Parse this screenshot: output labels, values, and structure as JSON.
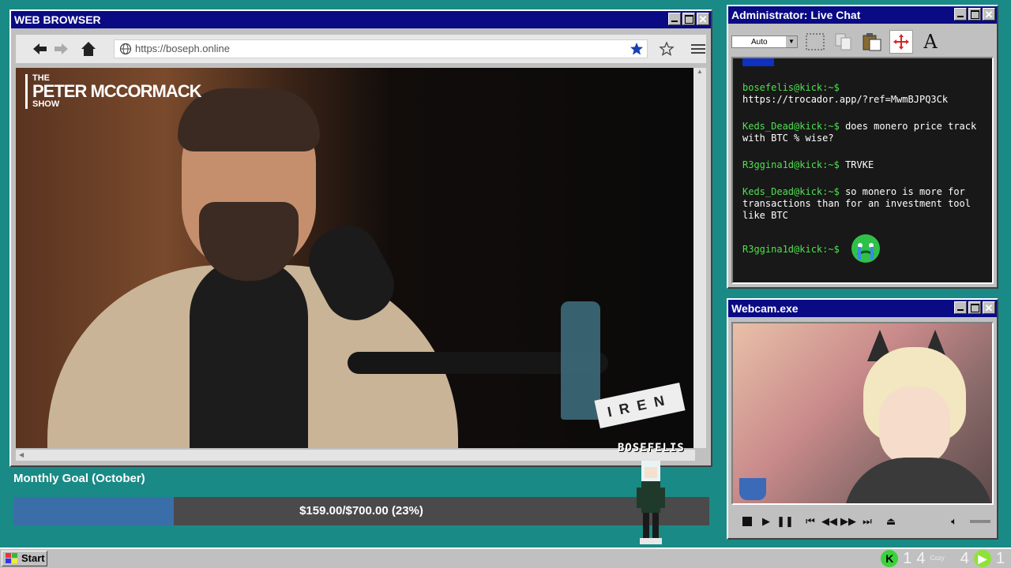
{
  "browser": {
    "title": "WEB BROWSER",
    "url": "https://boseph.online",
    "video": {
      "show_logo": [
        "THE",
        "PETER MCCORMACK",
        "SHOW"
      ],
      "sponsor": "IREN"
    }
  },
  "streamer_name": "BOSEFELIS",
  "goal": {
    "label": "Monthly Goal (October)",
    "text": "$159.00/$700.00 (23%)",
    "progress": 0.23
  },
  "chat": {
    "title": "Administrator: Live Chat",
    "auto_label": "Auto",
    "messages": [
      {
        "user": "bosefelis@kick:~$",
        "text": "https://trocador.app/?ref=MwmBJPQ3Ck"
      },
      {
        "user": "Keds_Dead@kick:~$",
        "text": "does monero price track with BTC % wise?"
      },
      {
        "user": "R3ggina1d@kick:~$",
        "text": "TRVKE"
      },
      {
        "user": "Keds_Dead@kick:~$",
        "text": "so monero is more for transactions than for an investment tool like BTC"
      },
      {
        "user": "R3ggina1d@kick:~$",
        "text": ""
      }
    ]
  },
  "webcam": {
    "title": "Webcam.exe"
  },
  "taskbar": {
    "start_label": "Start",
    "tray_items": [
      "1",
      "4",
      "4",
      "1"
    ],
    "tray_small_label": "Cozy"
  },
  "colors": {
    "desktop": "#1a8a86",
    "titlebar": "#0a0a84",
    "chat_user": "#4ee04e",
    "goal_fill": "#3a6ea8"
  }
}
